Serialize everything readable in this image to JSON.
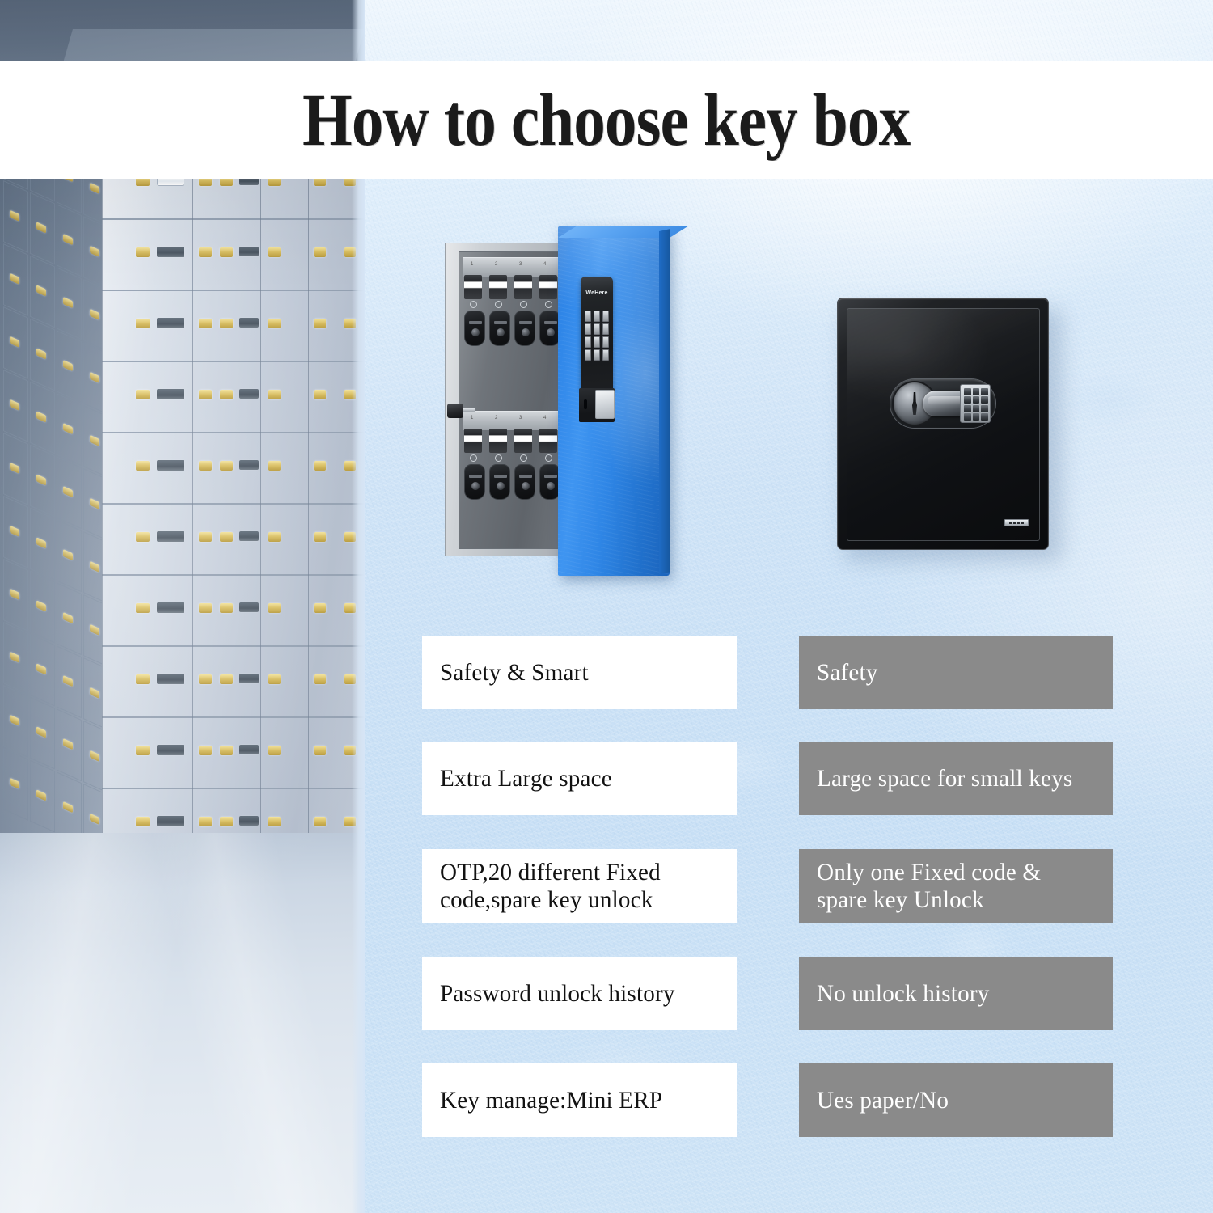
{
  "title": "How to choose key box",
  "scene": {
    "left_photo": "bank-vault-safe-deposit-boxes",
    "wall_color": "#cfe2f5",
    "vault_color": "#8d9cae"
  },
  "products": {
    "keybox": {
      "name": "smart-key-box",
      "brand": "WeHere",
      "door_color": "#2f86e8",
      "body_color": "#c4c9ce",
      "keypad_rows": 4,
      "keypad_cols": 3,
      "hook_rows": 2,
      "hooks_per_row": 4
    },
    "safe": {
      "name": "traditional-wall-safe",
      "body_color": "#111316",
      "keypad_rows": 4,
      "keypad_cols": 3
    }
  },
  "comparison": {
    "left_label": "smart-key-box",
    "right_label": "traditional-safe",
    "rows": [
      {
        "left": "Safety & Smart",
        "right": "Safety"
      },
      {
        "left": "Extra Large space",
        "right": "Large space for small keys"
      },
      {
        "left": "OTP,20 different Fixed code,spare key unlock",
        "right": "Only one Fixed code & spare key Unlock"
      },
      {
        "left": "Password unlock history",
        "right": "No unlock history"
      },
      {
        "left": "Key manage:Mini ERP",
        "right": "Ues paper/No"
      }
    ]
  },
  "colors": {
    "white_chip_bg": "#ffffff",
    "white_chip_text": "#121212",
    "gray_chip_bg": "#8a8a8a",
    "gray_chip_text": "#ffffff",
    "title_text": "#1b1b1b",
    "title_band_bg": "#ffffff"
  }
}
